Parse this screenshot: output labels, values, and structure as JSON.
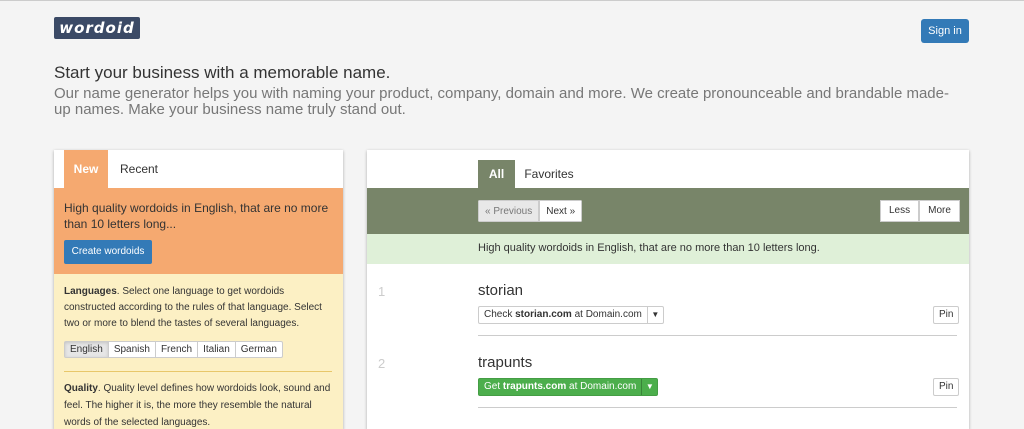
{
  "header": {
    "logo_text": "wordoid",
    "signin_label": "Sign in"
  },
  "intro": {
    "headline": "Start your business with a memorable name.",
    "lead": "Our name generator helps you with naming your product, company, domain and more. We create pronounceable and brandable made-up names. Make your business name truly stand out."
  },
  "left": {
    "tabs": [
      "New",
      "Recent"
    ],
    "description": "High quality wordoids in English, that are no more than 10 letters long...",
    "create_label": "Create wordoids",
    "languages_title": "Languages",
    "languages_text": ". Select one language to get wordoids constructed according to the rules of that language. Select two or more to blend the tastes of several languages.",
    "languages": [
      "English",
      "Spanish",
      "French",
      "Italian",
      "German"
    ],
    "selected_language": "English",
    "quality_title": "Quality",
    "quality_text": ". Quality level defines how wordoids look, sound and feel. The higher it is, the more they resemble the natural words of the selected languages."
  },
  "right": {
    "tabs": [
      "All",
      "Favorites"
    ],
    "prev_label": "« Previous",
    "next_label": "Next »",
    "less_label": "Less",
    "more_label": "More",
    "info": "High quality wordoids in English, that are no more than 10 letters long.",
    "results": [
      {
        "num": "1",
        "word": "storian",
        "check_prefix": "Check ",
        "domain": "storian.com",
        "check_suffix": " at Domain.com",
        "pin": "Pin"
      },
      {
        "num": "2",
        "word": "trapunts",
        "check_prefix": "Get ",
        "domain": "trapunts.com",
        "check_suffix": " at Domain.com",
        "pin": "Pin"
      }
    ]
  },
  "colors": {
    "accent": "#337ab7",
    "orange": "#f5a970",
    "olive": "#788569",
    "success": "#4cae4c"
  }
}
